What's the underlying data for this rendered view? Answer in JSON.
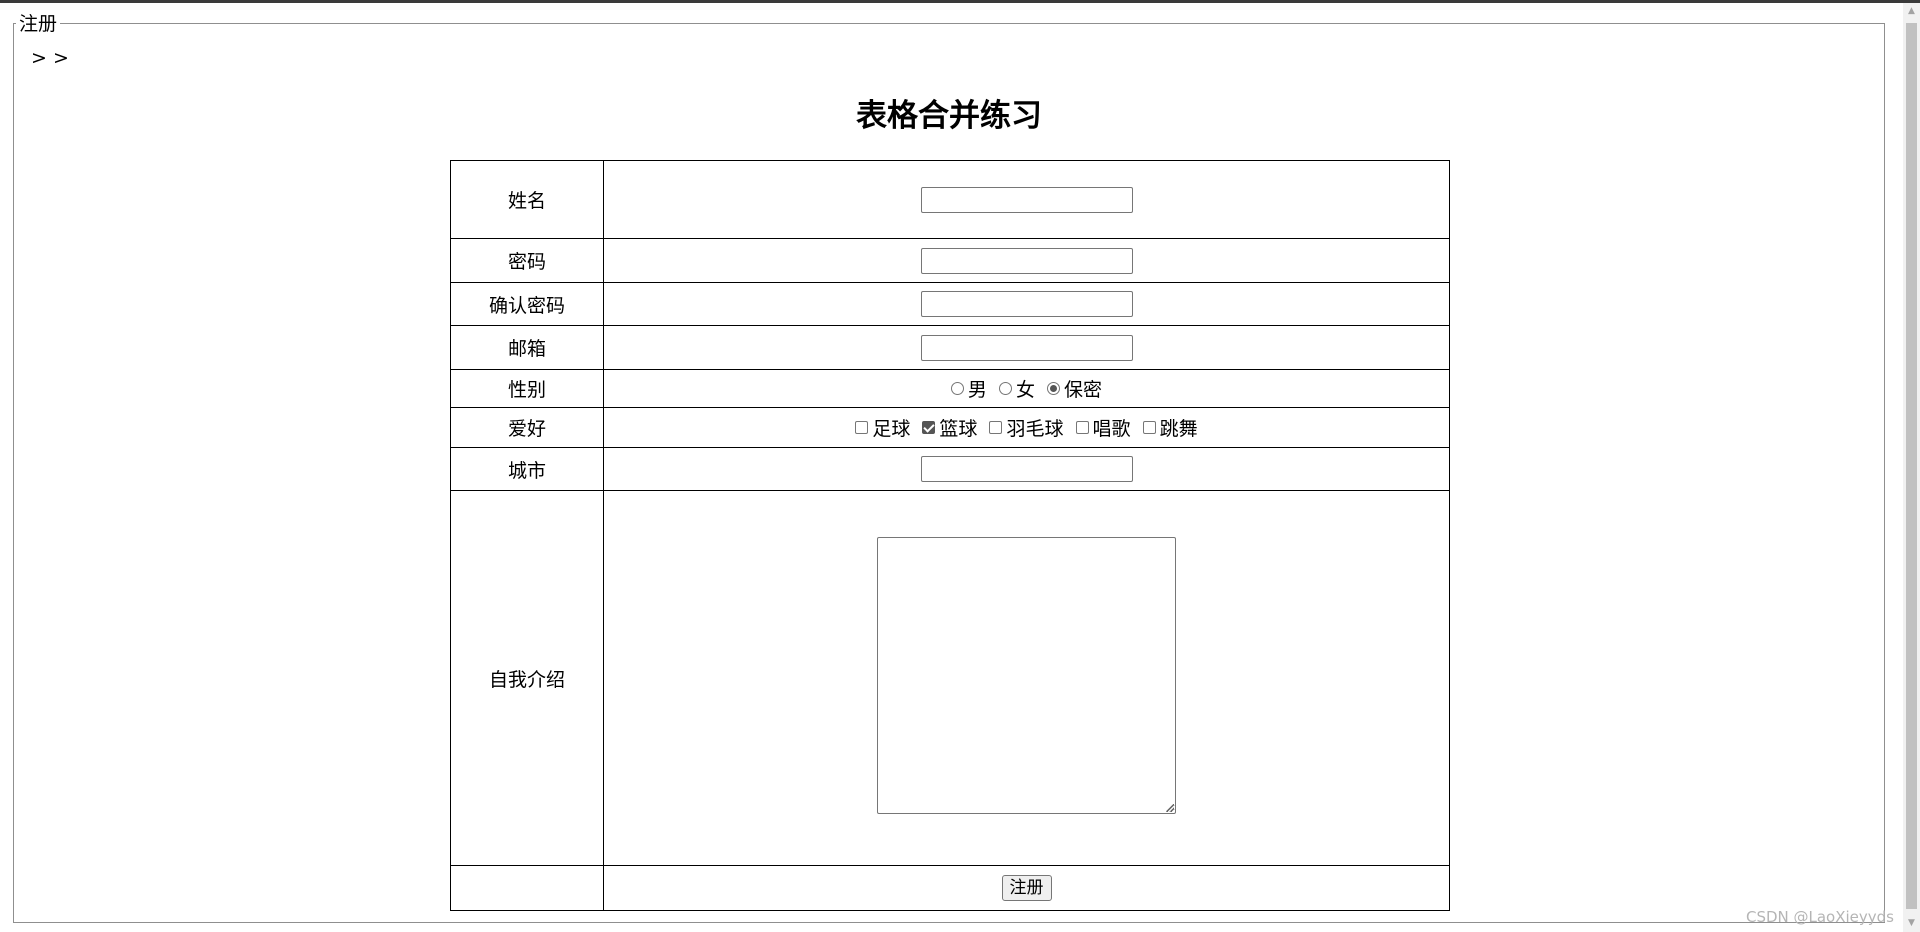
{
  "legend": "注册",
  "crumbs": "> >",
  "title": "表格合并练习",
  "rows": {
    "name": {
      "label": "姓名"
    },
    "password": {
      "label": "密码"
    },
    "confirm": {
      "label": "确认密码"
    },
    "email": {
      "label": "邮箱"
    },
    "gender": {
      "label": "性别",
      "options": [
        {
          "label": "男",
          "checked": false
        },
        {
          "label": "女",
          "checked": false
        },
        {
          "label": "保密",
          "checked": true
        }
      ]
    },
    "hobby": {
      "label": "爱好",
      "options": [
        {
          "label": "足球",
          "checked": false
        },
        {
          "label": "篮球",
          "checked": true
        },
        {
          "label": "羽毛球",
          "checked": false
        },
        {
          "label": "唱歌",
          "checked": false
        },
        {
          "label": "跳舞",
          "checked": false
        }
      ]
    },
    "city": {
      "label": "城市"
    },
    "intro": {
      "label": "自我介绍"
    }
  },
  "submit_label": "注册",
  "watermark": "CSDN @LaoXieyyds"
}
